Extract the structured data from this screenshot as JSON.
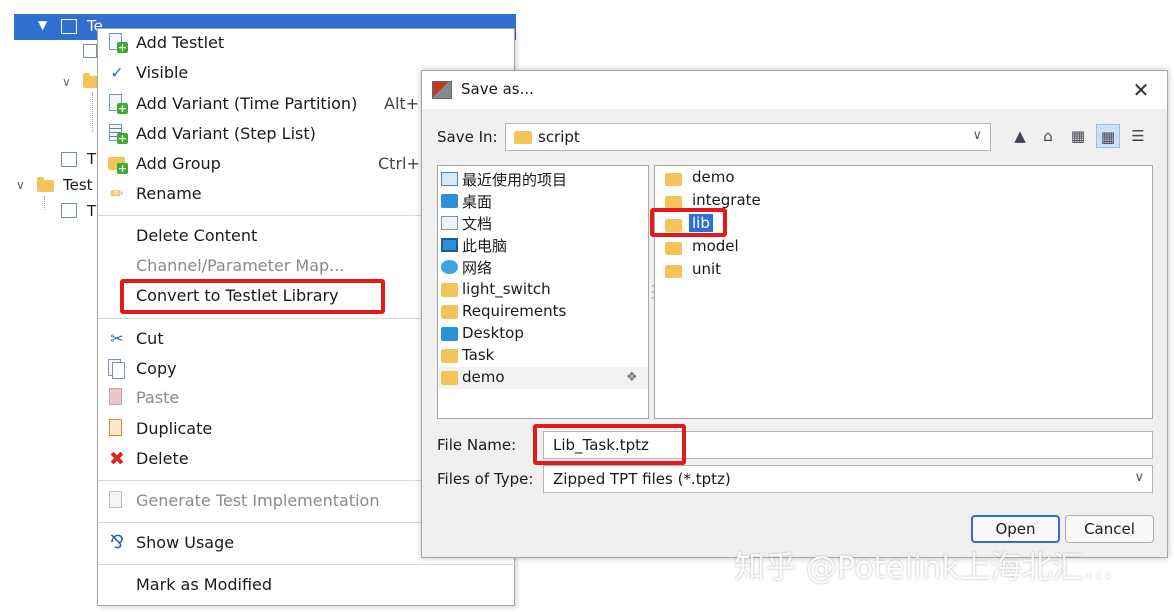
{
  "tree": {
    "items": [
      {
        "label": "Te"
      },
      {
        "label": "T"
      },
      {
        "label": "Test"
      },
      {
        "label": "T"
      }
    ]
  },
  "menu": {
    "items": [
      {
        "label": "Add Testlet",
        "icon": "add-testlet-icon"
      },
      {
        "label": "Visible",
        "icon": "checkmark-icon",
        "checked": true
      },
      {
        "label": "Add  Variant (Time Partition)",
        "shortcut": "Alt+",
        "icon": "add-variant-icon"
      },
      {
        "label": "Add  Variant (Step List)",
        "icon": "step-list-icon"
      },
      {
        "label": "Add Group",
        "shortcut": "Ctrl+",
        "icon": "add-group-icon"
      },
      {
        "label": "Rename",
        "icon": "pencil-icon"
      },
      {
        "label": "Delete Content"
      },
      {
        "label": "Channel/Parameter Map...",
        "disabled": true
      },
      {
        "label": "Convert to Testlet Library"
      },
      {
        "label": "Cut",
        "icon": "scissors-icon"
      },
      {
        "label": "Copy",
        "icon": "copy-icon"
      },
      {
        "label": "Paste",
        "icon": "paste-icon",
        "disabled": true
      },
      {
        "label": "Duplicate",
        "icon": "duplicate-icon"
      },
      {
        "label": "Delete",
        "icon": "delete-x-icon"
      },
      {
        "label": "Generate Test Implementation",
        "icon": "document-icon",
        "disabled": true
      },
      {
        "label": "Show Usage",
        "icon": "usage-icon"
      },
      {
        "label": "Mark as Modified"
      }
    ]
  },
  "dialog": {
    "title": "Save as...",
    "save_in_label": "Save In:",
    "save_in_value": "script",
    "places": [
      {
        "label": "最近使用的项目",
        "icon": "recent-icon"
      },
      {
        "label": "桌面",
        "icon": "desktop-icon"
      },
      {
        "label": "文档",
        "icon": "documents-icon"
      },
      {
        "label": "此电脑",
        "icon": "computer-icon"
      },
      {
        "label": "网络",
        "icon": "network-icon"
      },
      {
        "label": "light_switch",
        "icon": "folder-icon"
      },
      {
        "label": "Requirements",
        "icon": "folder-icon"
      },
      {
        "label": "Desktop",
        "icon": "desktop-icon"
      },
      {
        "label": "Task",
        "icon": "folder-icon"
      },
      {
        "label": "demo",
        "icon": "folder-icon"
      }
    ],
    "files": [
      {
        "label": "demo"
      },
      {
        "label": "integrate"
      },
      {
        "label": "lib",
        "selected": true
      },
      {
        "label": "model"
      },
      {
        "label": "unit"
      }
    ],
    "file_name_label": "File Name:",
    "file_name_value": "Lib_Task.tptz",
    "file_type_label": "Files of Type:",
    "file_type_value": "Zipped TPT files (*.tptz)",
    "open_label": "Open",
    "cancel_label": "Cancel"
  },
  "watermark": "知乎 @Potelink上海北汇...",
  "colors": {
    "highlight": "#e3191c",
    "selection": "#2f6fcf"
  }
}
